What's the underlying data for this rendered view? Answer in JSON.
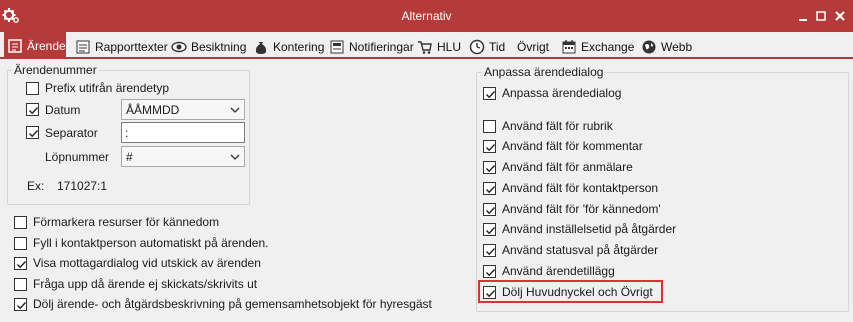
{
  "window": {
    "title": "Alternativ"
  },
  "tabs": [
    {
      "label": "Ärende",
      "icon": "case-icon",
      "active": true
    },
    {
      "label": "Rapporttexter",
      "icon": "report-icon"
    },
    {
      "label": "Besiktning",
      "icon": "eye-icon"
    },
    {
      "label": "Kontering",
      "icon": "money-bag-icon"
    },
    {
      "label": "Notifieringar",
      "icon": "notification-icon"
    },
    {
      "label": "HLU",
      "icon": "cart-icon"
    },
    {
      "label": "Tid",
      "icon": "clock-icon"
    },
    {
      "label": "Övrigt",
      "icon": ""
    },
    {
      "label": "Exchange",
      "icon": "calendar-icon"
    },
    {
      "label": "Webb",
      "icon": "globe-icon"
    }
  ],
  "arendenummer": {
    "title": "Ärendenummer",
    "prefix": {
      "label": "Prefix utifrån ärendetyp",
      "checked": false
    },
    "datum": {
      "label": "Datum",
      "checked": true,
      "value": "ÅÅMMDD"
    },
    "separator": {
      "label": "Separator",
      "checked": true,
      "value": ":"
    },
    "lopnummer": {
      "label": "Löpnummer",
      "value": "#"
    },
    "example_label": "Ex:",
    "example_value": "171027:1"
  },
  "options": [
    {
      "label": "Förmarkera resurser för kännedom",
      "checked": false
    },
    {
      "label": "Fyll i kontaktperson automatiskt på ärenden.",
      "checked": false
    },
    {
      "label": "Visa mottagardialog vid utskick av ärenden",
      "checked": true
    },
    {
      "label": "Fråga upp då ärende ej skickats/skrivits ut",
      "checked": false
    },
    {
      "label": "Dölj ärende- och åtgärdsbeskrivning på gemensamhetsobjekt för hyresgäst",
      "checked": true
    }
  ],
  "anpassa": {
    "title": "Anpassa ärendedialog",
    "main": {
      "label": "Anpassa ärendedialog",
      "checked": true
    },
    "items": [
      {
        "label": "Använd fält för rubrik",
        "checked": false
      },
      {
        "label": "Använd fält för kommentar",
        "checked": true
      },
      {
        "label": "Använd fält för anmälare",
        "checked": true
      },
      {
        "label": "Använd fält för kontaktperson",
        "checked": true
      },
      {
        "label": "Använd fält för 'för kännedom'",
        "checked": true
      },
      {
        "label": "Använd inställelsetid på åtgärder",
        "checked": true
      },
      {
        "label": "Använd statusval på åtgärder",
        "checked": true
      },
      {
        "label": "Använd ärendetillägg",
        "checked": true
      },
      {
        "label": "Dölj Huvudnyckel och Övrigt",
        "checked": true,
        "highlighted": true
      }
    ]
  },
  "colors": {
    "accent": "#b53a3a",
    "highlight": "#e03030"
  }
}
